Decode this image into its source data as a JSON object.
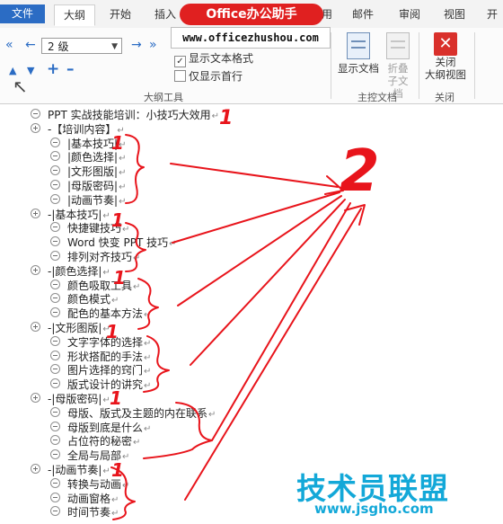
{
  "brand": {
    "label": "Office办公助手",
    "color": "#e02020"
  },
  "tabs": [
    {
      "label": "文件"
    },
    {
      "label": "大纲"
    },
    {
      "label": "开始"
    },
    {
      "label": "插入"
    },
    {
      "label": "用"
    },
    {
      "label": "邮件"
    },
    {
      "label": "审阅"
    },
    {
      "label": "视图"
    },
    {
      "label": "开"
    }
  ],
  "ribbon": {
    "outline_level": "2 级",
    "url_overlay": "www.officezhushou.com",
    "show_text_format": "显示文本格式",
    "show_first_line_only": "仅显示首行",
    "show_text_format_checked": true,
    "show_first_line_only_checked": false,
    "group_outline_tools": "大纲工具",
    "show_document": "显示文档",
    "collapse_subdocument_1": "折叠",
    "collapse_subdocument_2": "子文档",
    "group_master_document": "主控文档",
    "close_outline_1": "关闭",
    "close_outline_2": "大纲视图",
    "group_close": "关闭"
  },
  "outline": [
    {
      "text": "PPT 实战技能培训：小技巧大效用",
      "level": 1
    },
    {
      "text": "-【培训内容】",
      "level": 1,
      "collapsed": true
    },
    {
      "text": "|基本技巧|",
      "level": 2
    },
    {
      "text": "|颜色选择|",
      "level": 2
    },
    {
      "text": "|文形图版|",
      "level": 2
    },
    {
      "text": "|母版密码|",
      "level": 2
    },
    {
      "text": "|动画节奏|",
      "level": 2
    },
    {
      "text": "-|基本技巧|",
      "level": 1,
      "collapsed": true
    },
    {
      "text": "快捷键技巧",
      "level": 2
    },
    {
      "text": "Word 快变 PPT 技巧",
      "level": 2
    },
    {
      "text": "排列对齐技巧",
      "level": 2
    },
    {
      "text": "-|颜色选择|",
      "level": 1,
      "collapsed": true
    },
    {
      "text": "颜色吸取工具",
      "level": 2
    },
    {
      "text": "颜色模式",
      "level": 2
    },
    {
      "text": "配色的基本方法",
      "level": 2
    },
    {
      "text": "-|文形图版|",
      "level": 1,
      "collapsed": true
    },
    {
      "text": "文字字体的选择",
      "level": 2
    },
    {
      "text": "形状搭配的手法",
      "level": 2
    },
    {
      "text": "图片选择的窍门",
      "level": 2
    },
    {
      "text": "版式设计的讲究",
      "level": 2
    },
    {
      "text": "-|母版密码|",
      "level": 1,
      "collapsed": true
    },
    {
      "text": "母版、版式及主题的内在联系",
      "level": 2
    },
    {
      "text": "母版到底是什么",
      "level": 2
    },
    {
      "text": "占位符的秘密",
      "level": 2
    },
    {
      "text": "全局与局部",
      "level": 2
    },
    {
      "text": "-|动画节奏|",
      "level": 1,
      "collapsed": true
    },
    {
      "text": "转换与动画",
      "level": 2
    },
    {
      "text": "动画窗格",
      "level": 2
    },
    {
      "text": "时间节奏",
      "level": 2
    }
  ],
  "annotations": {
    "mark_1": "1",
    "mark_2": "2",
    "color": "#e8141b"
  },
  "watermark": {
    "title": "技术员联盟",
    "url": "www.jsgho.com",
    "color": "#13a8d8"
  }
}
